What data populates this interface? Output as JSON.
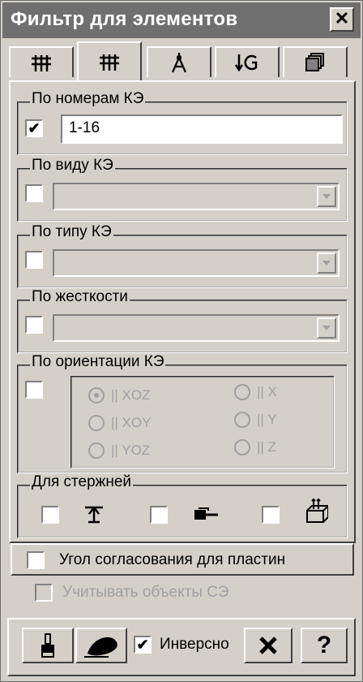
{
  "window": {
    "title": "Фильтр для элементов",
    "close_glyph": "✕"
  },
  "tabs": [
    {
      "icon": "grid-icon"
    },
    {
      "icon": "grid-icon"
    },
    {
      "icon": "compass-icon"
    },
    {
      "icon": "arrow-g-icon"
    },
    {
      "icon": "layers-icon"
    }
  ],
  "groups": {
    "by_numbers": {
      "label": "По номерам КЭ",
      "checked": true,
      "value": "1-16"
    },
    "by_kind": {
      "label": "По виду КЭ",
      "checked": false,
      "value": ""
    },
    "by_type": {
      "label": "По типу КЭ",
      "checked": false,
      "value": ""
    },
    "by_stiffness": {
      "label": "По жесткости",
      "checked": false,
      "value": ""
    },
    "by_orientation": {
      "label": "По ориентации КЭ",
      "checked": false,
      "options": [
        {
          "label": "|| XOZ",
          "selected": true
        },
        {
          "label": "|| XOY",
          "selected": false
        },
        {
          "label": "|| YOZ",
          "selected": false
        },
        {
          "label": "|| X",
          "selected": false
        },
        {
          "label": "|| Y",
          "selected": false
        },
        {
          "label": "|| Z",
          "selected": false
        }
      ]
    },
    "for_rods": {
      "label": "Для стержней"
    }
  },
  "plate_angle": {
    "label": "Угол согласования для пластин",
    "checked": false
  },
  "se_objects": {
    "label": "Учитывать объекты СЭ",
    "checked": false,
    "disabled": true
  },
  "footer": {
    "inverse_label": "Инверсно",
    "inverse_checked": true,
    "help_glyph": "?"
  },
  "check_glyph": "✔"
}
